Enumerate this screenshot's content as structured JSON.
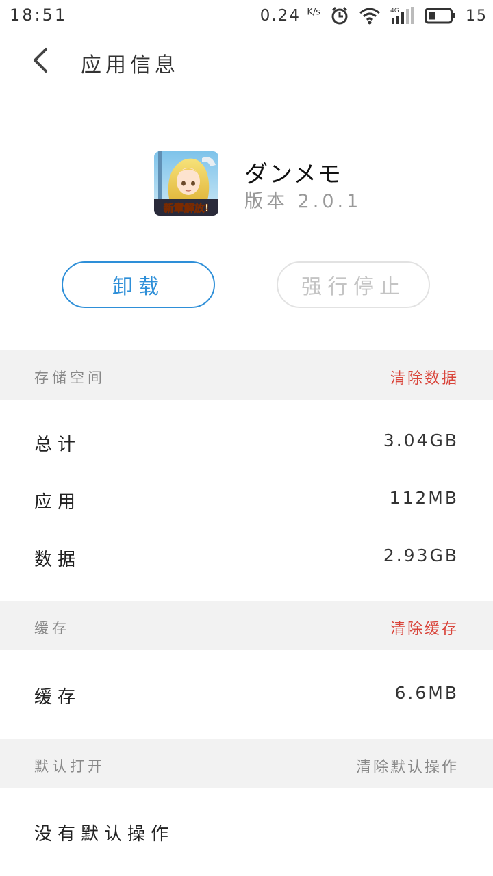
{
  "status_bar": {
    "time": "18:51",
    "net_speed": "0.24",
    "net_unit": "K/s",
    "network_type": "4G",
    "battery": "15"
  },
  "app_bar": {
    "back_icon": "chevron-left-icon",
    "title": "应用信息"
  },
  "app": {
    "name": "ダンメモ",
    "version": "版本 2.0.1",
    "icon_banner": "新章解放!"
  },
  "actions": {
    "uninstall": "卸载",
    "force_stop": "强行停止"
  },
  "storage": {
    "title": "存储空间",
    "action": "清除数据",
    "rows": [
      {
        "label": "总计",
        "value": "3.04GB"
      },
      {
        "label": "应用",
        "value": "112MB"
      },
      {
        "label": "数据",
        "value": "2.93GB"
      }
    ]
  },
  "cache": {
    "title": "缓存",
    "action": "清除缓存",
    "rows": [
      {
        "label": "缓存",
        "value": "6.6MB"
      }
    ]
  },
  "defaults": {
    "title": "默认打开",
    "action": "清除默认操作",
    "text": "没有默认操作"
  },
  "colors": {
    "accent_blue": "#2e8fd8",
    "danger_red": "#d9453b",
    "section_bg": "#f2f2f2"
  }
}
